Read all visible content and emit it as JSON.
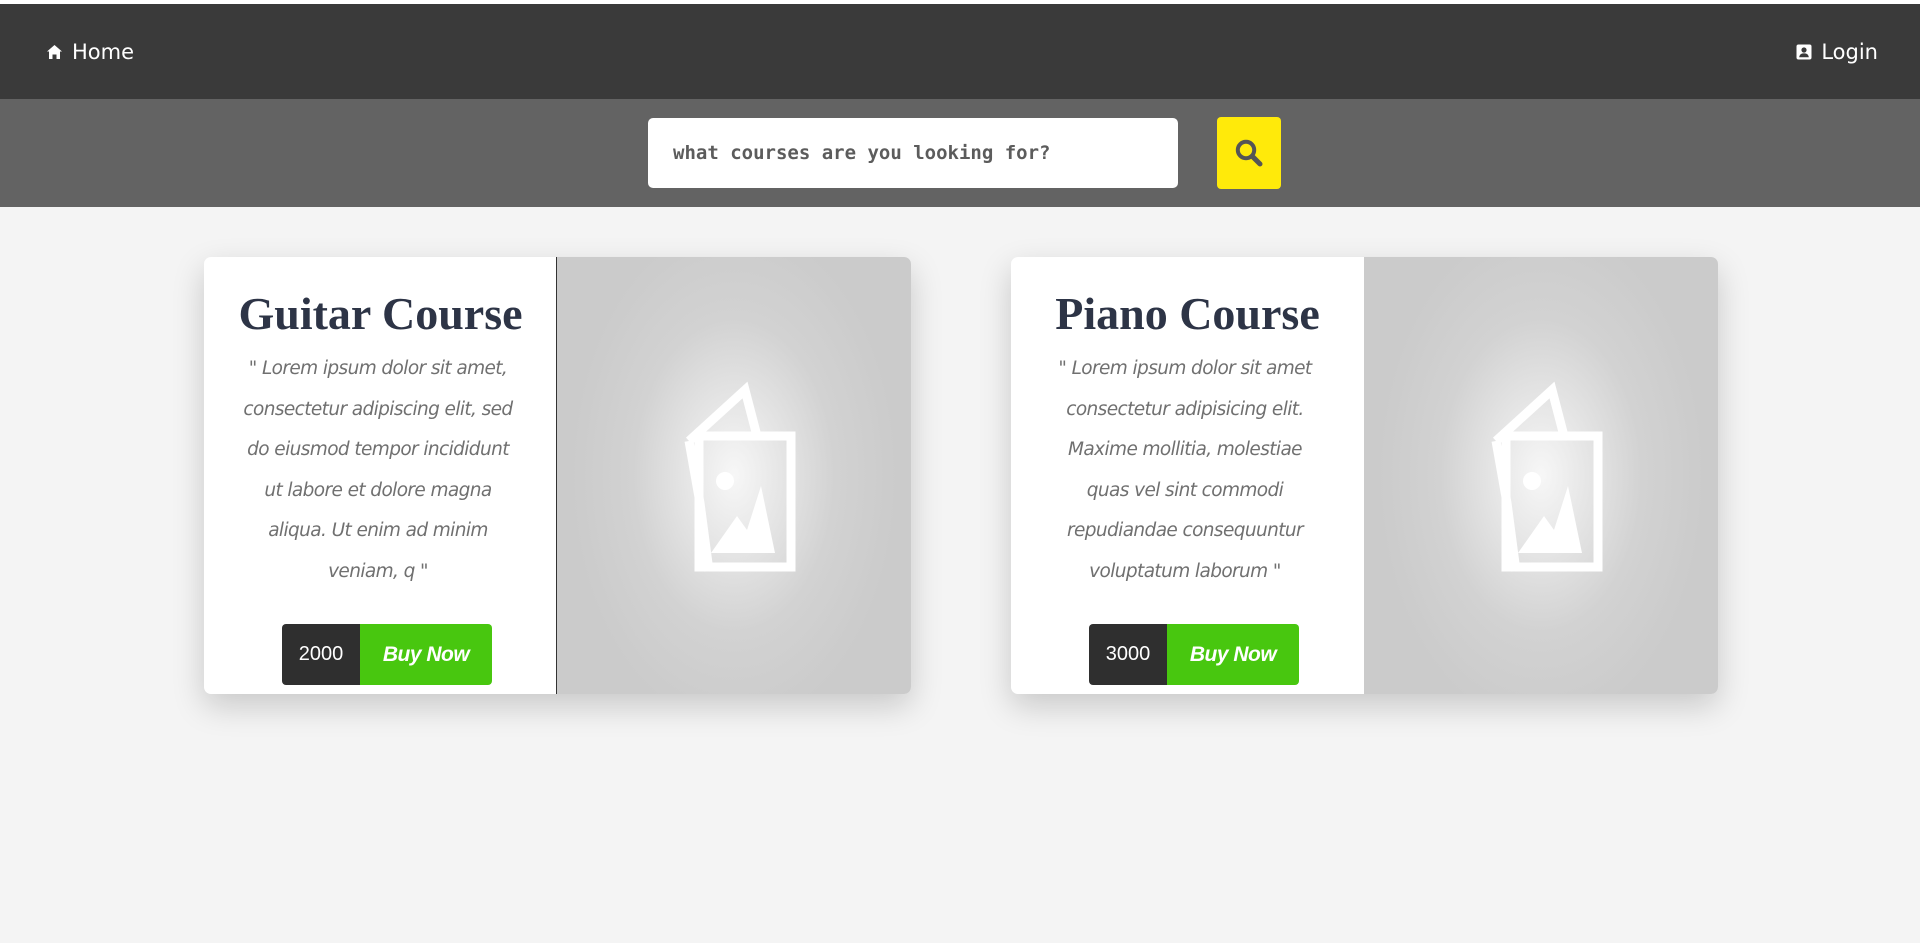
{
  "nav": {
    "home_label": "Home",
    "home_icon": "home-icon",
    "login_label": "Login",
    "login_icon": "user-badge-icon"
  },
  "search": {
    "placeholder": "what courses are you looking for?",
    "value": "",
    "button_icon": "search-icon"
  },
  "colors": {
    "navbar": "#3a3a3a",
    "search_band": "#636363",
    "search_button": "#ffea0a",
    "buy_button": "#48c70f",
    "price_tag": "#2f2f2f",
    "title": "#2d3446"
  },
  "courses": [
    {
      "title": "Guitar Course",
      "description": "\" Lorem ipsum dolor sit amet, consectetur adipiscing elit, sed do eiusmod tempor incididunt ut labore et dolore magna aliqua. Ut enim ad minim veniam, q \"",
      "price": "2000",
      "buy_label": "Buy Now",
      "image_icon": "image-placeholder-icon"
    },
    {
      "title": "Piano Course",
      "description": "\" Lorem ipsum dolor sit amet consectetur adipisicing elit. Maxime mollitia, molestiae quas vel sint commodi repudiandae consequuntur voluptatum laborum \"",
      "price": "3000",
      "buy_label": "Buy Now",
      "image_icon": "image-placeholder-icon"
    }
  ]
}
